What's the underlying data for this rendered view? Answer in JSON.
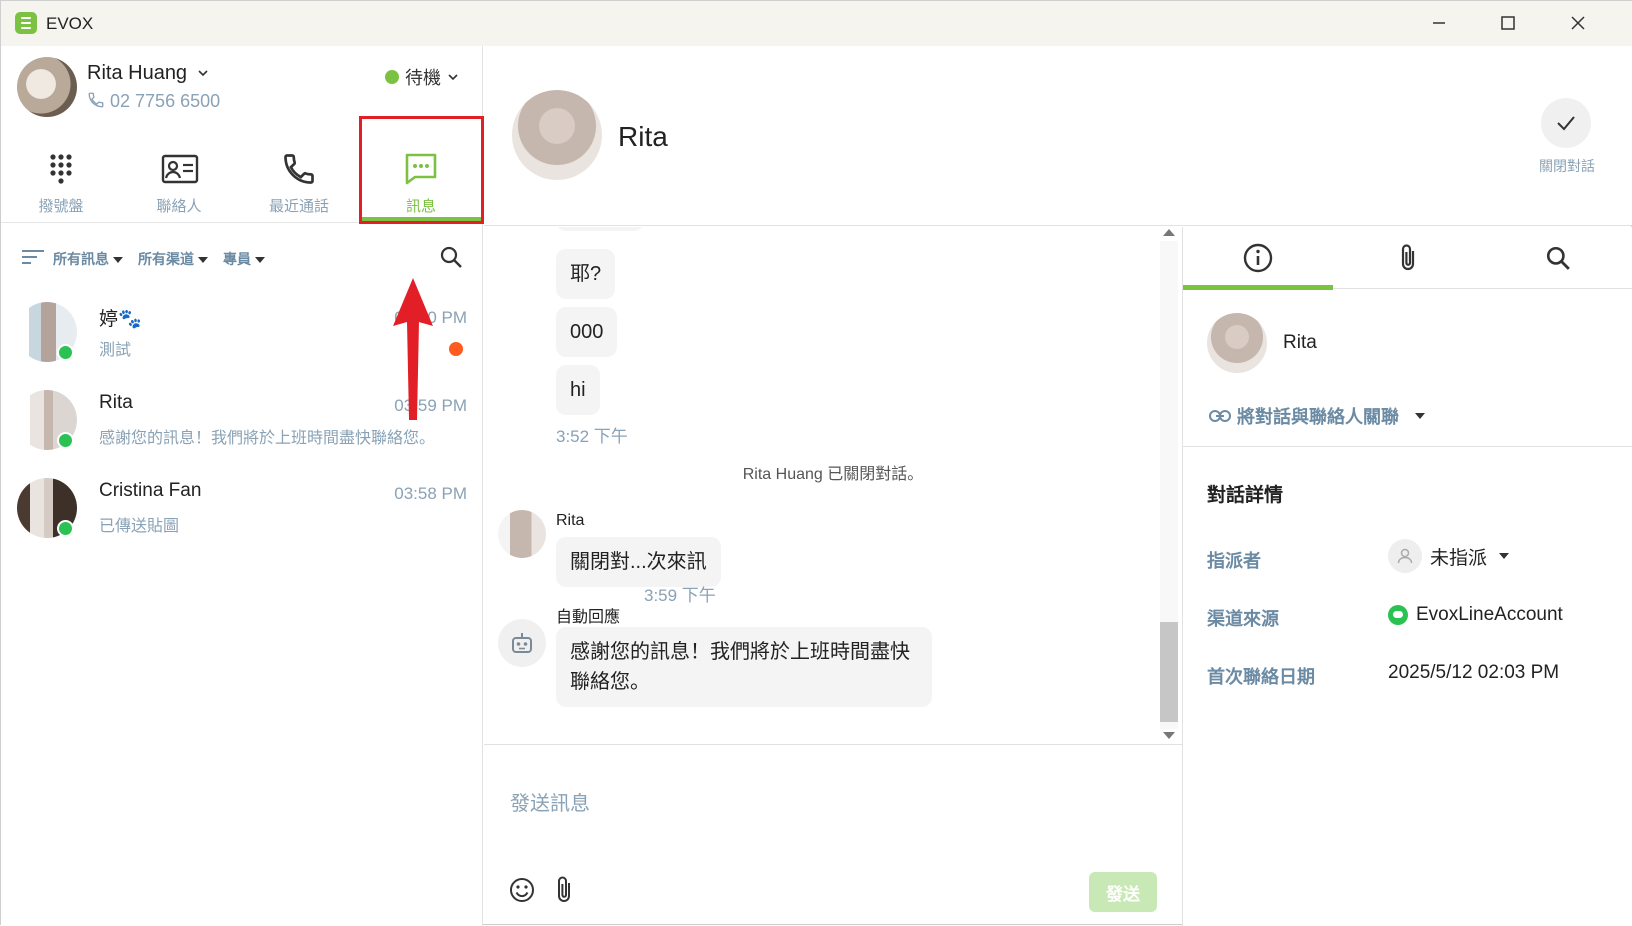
{
  "app": {
    "title": "EVOX"
  },
  "window": {
    "minimize": "—",
    "maximize": "☐",
    "close": "✕"
  },
  "profile": {
    "name": "Rita Huang",
    "phone": "02 7756 6500",
    "status": "待機",
    "status_color": "#7cc242"
  },
  "nav": {
    "items": [
      {
        "label": "撥號盤",
        "icon": "dialpad-icon"
      },
      {
        "label": "聯絡人",
        "icon": "contact-card-icon"
      },
      {
        "label": "最近通話",
        "icon": "phone-icon"
      },
      {
        "label": "訊息",
        "icon": "message-icon"
      }
    ],
    "active_index": 3
  },
  "filters": {
    "all_messages": "所有訊息",
    "all_channels": "所有渠道",
    "agent": "專員"
  },
  "conversations": [
    {
      "name": "婷🐾",
      "time": "04:00 PM",
      "preview": "測試",
      "unread": true
    },
    {
      "name": "Rita",
      "time": "03:59 PM",
      "preview": "感謝您的訊息！我們將於上班時間盡快聯絡您。",
      "unread": false
    },
    {
      "name": "Cristina Fan",
      "time": "03:58 PM",
      "preview": "已傳送貼圖",
      "unread": false
    }
  ],
  "chat": {
    "title": "Rita",
    "close_label": "關閉對話",
    "messages": {
      "m1": "耶?",
      "m2": "000",
      "m3": "hi",
      "t1": "3:52 下午",
      "system": "Rita Huang 已關閉對話。",
      "rita_sender": "Rita",
      "rita_msg": "關閉對...次來訊",
      "t2": "3:59 下午",
      "bot_sender": "自動回應",
      "bot_msg": "感謝您的訊息！我們將於上班時間盡快聯絡您。"
    },
    "composer_placeholder": "發送訊息",
    "send_label": "發送"
  },
  "details": {
    "contact_name": "Rita",
    "link_label": "將對話與聯絡人關聯",
    "title": "對話詳情",
    "assignee_label": "指派者",
    "assignee_value": "未指派",
    "channel_label": "渠道來源",
    "channel_value": "EvoxLineAccount",
    "first_contact_label": "首次聯絡日期",
    "first_contact_value": "2025/5/12 02:03 PM"
  },
  "colors": {
    "accent": "#7cc242",
    "highlight": "#e21f26",
    "unread": "#ff5a1f",
    "muted": "#8aa2b6"
  }
}
